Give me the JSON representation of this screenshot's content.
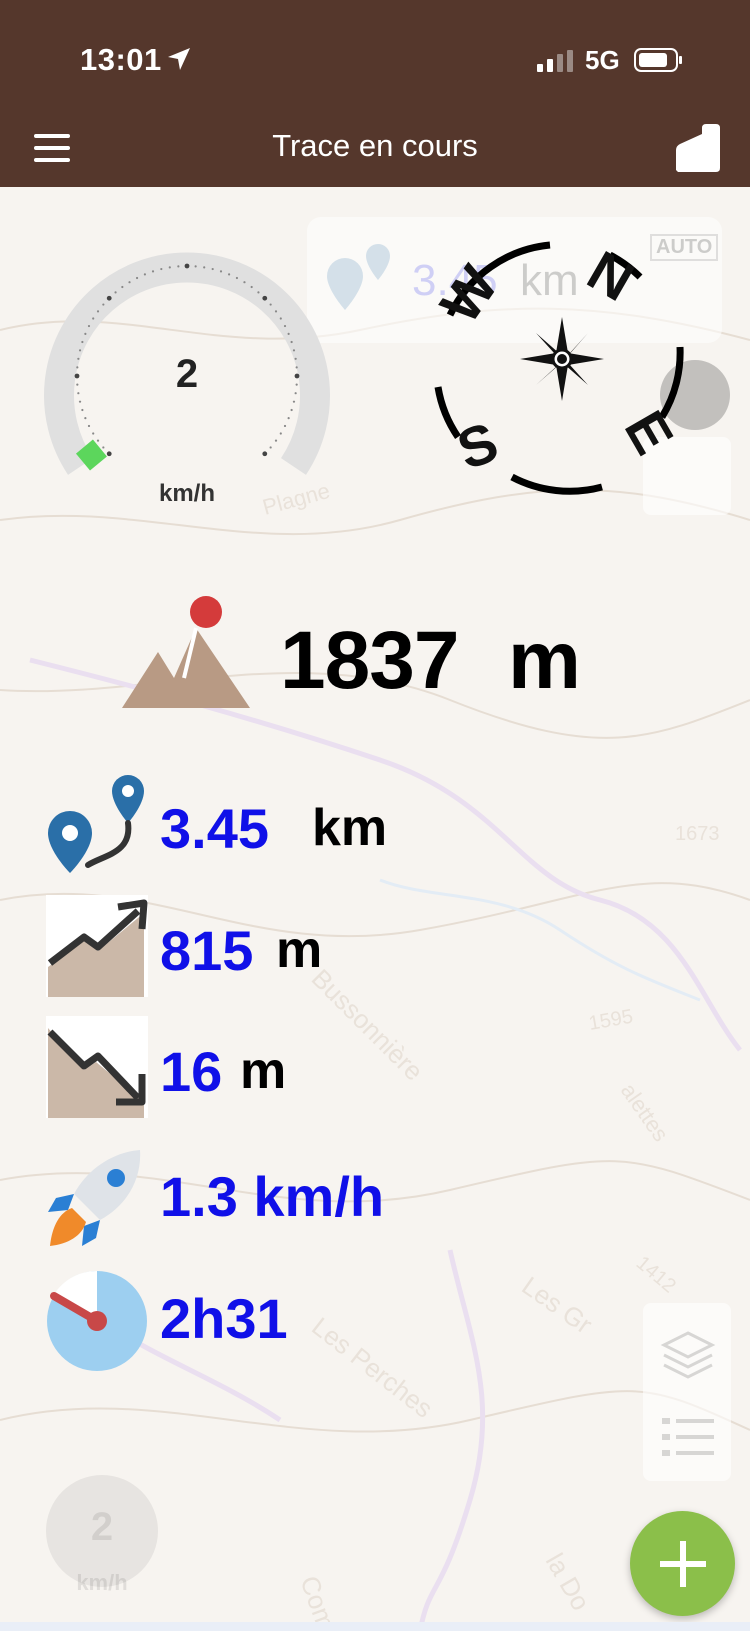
{
  "status": {
    "time": "13:01",
    "network": "5G",
    "icons": [
      "location-arrow-icon",
      "signal-icon",
      "battery-icon"
    ]
  },
  "nav": {
    "title": "Trace en cours",
    "icons": [
      "menu-icon",
      "route-icon"
    ]
  },
  "speedometer": {
    "value": "2",
    "unit": "km/h",
    "fraction": 0.02
  },
  "compass": {
    "labels": {
      "north": "N",
      "east": "E",
      "south": "S",
      "west": "W"
    }
  },
  "altitude": {
    "value": "1837",
    "unit": "m",
    "icon": "mountain-icon"
  },
  "stats": {
    "distance": {
      "value": "3.45",
      "unit": "km",
      "icon": "route-pin-icon"
    },
    "ascent": {
      "value": "815",
      "unit": "m",
      "icon": "ascent-icon"
    },
    "descent": {
      "value": "16",
      "unit": "m",
      "icon": "descent-icon"
    },
    "avg_speed": {
      "value": "1.3 km/h",
      "icon": "rocket-icon"
    },
    "duration": {
      "value": "2h31",
      "icon": "timer-icon"
    }
  },
  "background_ghost": {
    "distance_value": "3.45",
    "distance_unit": "km",
    "auto_label": "AUTO",
    "speed_value": "2",
    "speed_unit": "km/h"
  },
  "map_labels": [
    "Bussonnière",
    "Les Perches",
    "Les Gr",
    "1595",
    "1412",
    "1673",
    "la Do",
    "alettes",
    "Plagne",
    "Combe de"
  ],
  "fab": {
    "icon": "plus-icon"
  },
  "colors": {
    "header": "#55372c",
    "value_blue": "#1010e8",
    "fab_green": "#8bbf4a",
    "speed_needle": "#5cd65c",
    "gauge_track": "#e0e0e0"
  }
}
